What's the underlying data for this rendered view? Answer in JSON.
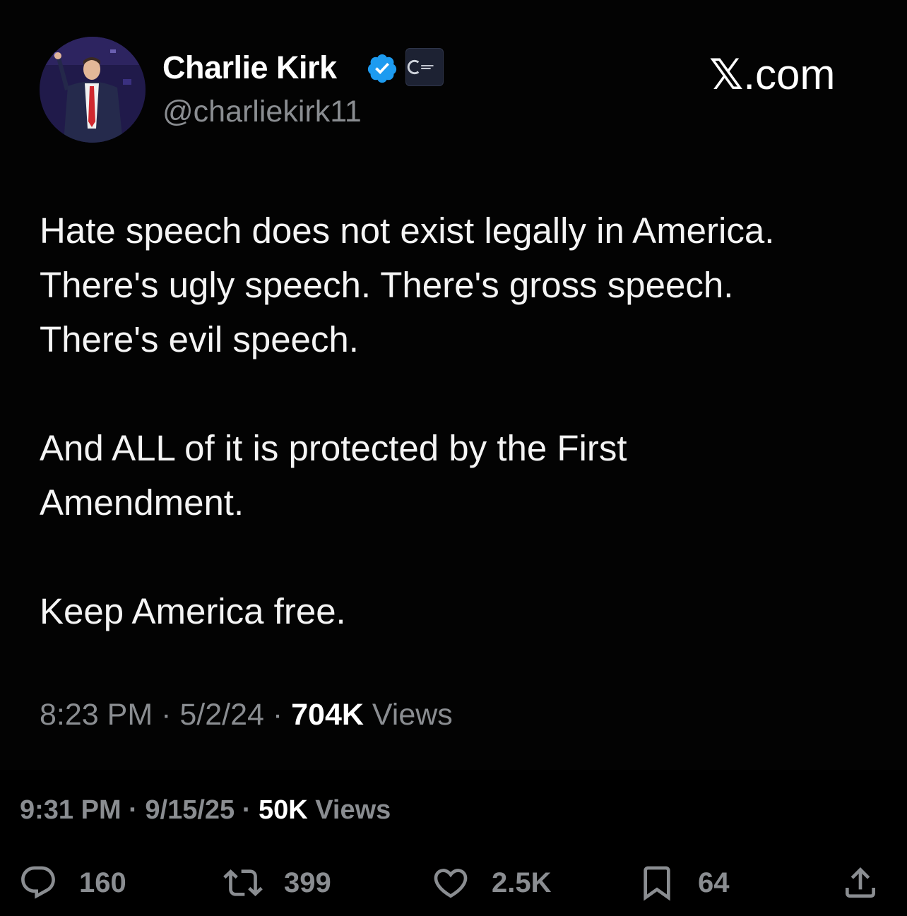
{
  "author": {
    "name": "Charlie Kirk",
    "handle": "@charliekirk11",
    "verified_color": "#1d9bf0"
  },
  "brand": {
    "mark": "𝕏",
    "suffix": ".com"
  },
  "tweet": {
    "paragraphs": [
      {
        "lines": [
          "Hate speech does not exist legally in America.",
          "There's ugly speech. There's gross speech.",
          "There's evil speech."
        ]
      },
      {
        "lines": [
          "And ALL of it is protected by the First",
          "Amendment."
        ]
      },
      {
        "lines": [
          "Keep America free."
        ]
      }
    ]
  },
  "original_meta": {
    "time": "8:23 PM",
    "sep1": " · ",
    "date": "5/2/24",
    "sep2": " · ",
    "views": "704K",
    "views_label": " Views"
  },
  "post_meta": {
    "time": "9:31 PM",
    "sep1": " · ",
    "date": "9/15/25",
    "sep2": " · ",
    "views": "50K",
    "views_label": " Views"
  },
  "actions": {
    "replies": "160",
    "reposts": "399",
    "likes": "2.5K",
    "bookmarks": "64"
  },
  "icons": {
    "reply": "speech-bubble-icon",
    "repost": "repost-arrows-icon",
    "like": "heart-icon",
    "bookmark": "bookmark-icon",
    "share": "share-upload-icon"
  },
  "colors": {
    "background": "#000000",
    "text": "#f4f4f4",
    "muted": "#8a8d91"
  }
}
